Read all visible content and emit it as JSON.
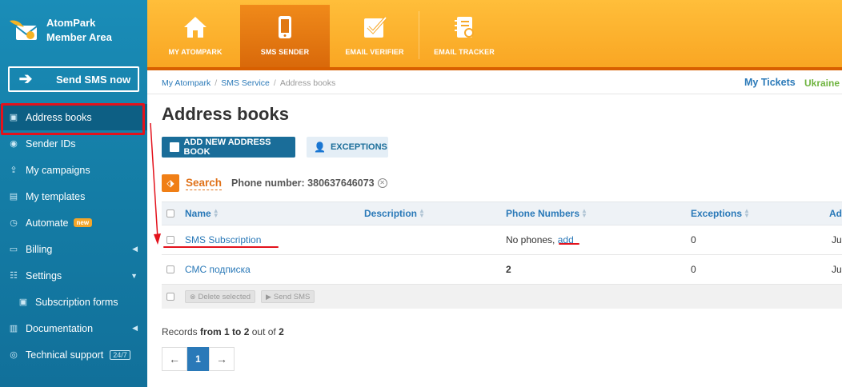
{
  "sidebar": {
    "brand": {
      "line1": "AtomPark",
      "line2": "Member Area"
    },
    "send_button": "Send SMS now",
    "items": [
      {
        "label": "Address books",
        "icon": "address-book-icon"
      },
      {
        "label": "Sender IDs",
        "icon": "user-circle-icon"
      },
      {
        "label": "My campaigns",
        "icon": "upload-icon"
      },
      {
        "label": "My templates",
        "icon": "chat-icon"
      },
      {
        "label": "Automate",
        "icon": "clock-icon",
        "badge": "new"
      },
      {
        "label": "Billing",
        "icon": "wallet-icon"
      },
      {
        "label": "Settings",
        "icon": "sliders-icon"
      },
      {
        "label": "Subscription forms",
        "icon": "form-icon"
      },
      {
        "label": "Documentation",
        "icon": "book-icon"
      },
      {
        "label": "Technical support",
        "icon": "lifebuoy-icon",
        "badge": "24/7"
      }
    ]
  },
  "topnav": {
    "tabs": [
      {
        "label": "MY ATOMPARK",
        "icon": "home-icon"
      },
      {
        "label": "SMS SENDER",
        "icon": "phone-icon",
        "active": true
      },
      {
        "label": "EMAIL VERIFIER",
        "icon": "checkbox-icon"
      },
      {
        "label": "EMAIL TRACKER",
        "icon": "notebook-icon"
      }
    ]
  },
  "breadcrumb": {
    "items": [
      "My Atompark",
      "SMS Service",
      "Address books"
    ]
  },
  "header_links": {
    "tickets": "My Tickets",
    "country": "Ukraine"
  },
  "page": {
    "title": "Address books",
    "add_button": "ADD NEW ADDRESS BOOK",
    "exceptions_button": "EXCEPTIONS",
    "search_label": "Search",
    "filter_label": "Phone number: 380637646073"
  },
  "table": {
    "columns": [
      "Name",
      "Description",
      "Phone Numbers",
      "Exceptions",
      "Ad"
    ],
    "rows": [
      {
        "name": "SMS Subscription",
        "description": "",
        "phones_prefix": "No phones,",
        "phones_link": "add",
        "exceptions": "0",
        "added": "Jul"
      },
      {
        "name": "СМС подписка",
        "description": "",
        "phones": "2",
        "exceptions": "0",
        "added": "Jul"
      }
    ],
    "footer": {
      "delete": "Delete selected",
      "send": "Send SMS"
    }
  },
  "records": {
    "prefix": "Records",
    "from_to": "from 1 to 2",
    "mid": "out of",
    "total": "2"
  },
  "pager": {
    "prev": "←",
    "current": "1",
    "next": "→"
  },
  "colors": {
    "accent": "#2a79b8",
    "highlight": "#e3121c",
    "brand_orange": "#f9a623"
  }
}
